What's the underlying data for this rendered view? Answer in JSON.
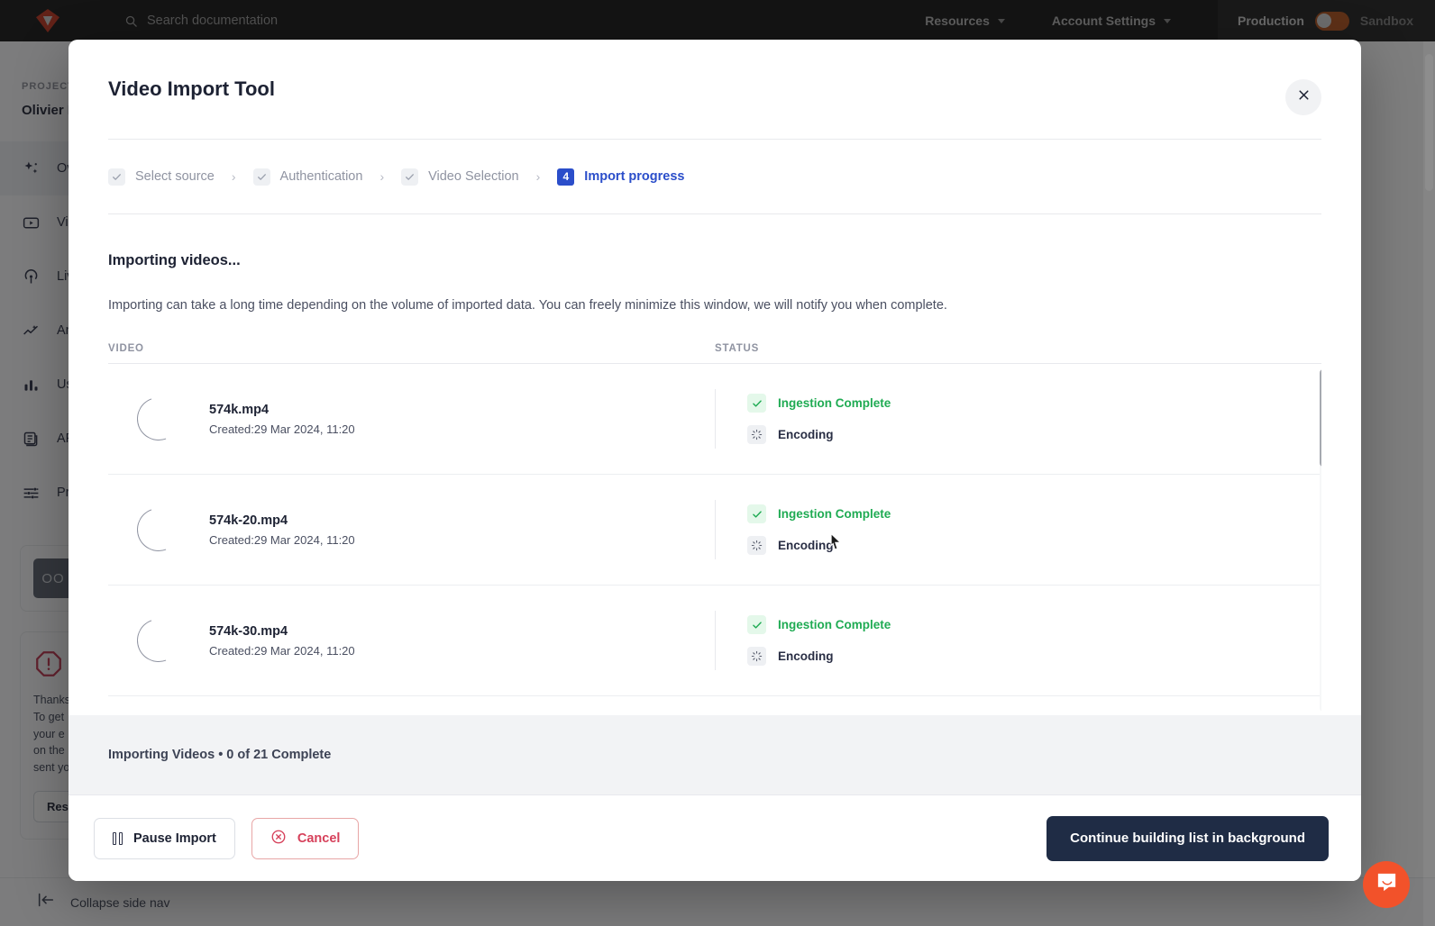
{
  "topbar": {
    "search_placeholder": "Search documentation",
    "search_icon": "search-icon",
    "menus": [
      {
        "label": "Resources",
        "icon": "chevron-down-icon"
      },
      {
        "label": "Account Settings",
        "icon": "chevron-down-icon"
      }
    ],
    "env_left": "Production",
    "env_right": "Sandbox",
    "toggle_color": "#b5521b"
  },
  "sidebar": {
    "project_label": "PROJECT:",
    "project_name": "Olivier P",
    "items": [
      {
        "label": "Ov",
        "icon": "sparkle-icon",
        "active": true
      },
      {
        "label": "Vi",
        "icon": "video-play-icon",
        "active": false
      },
      {
        "label": "Liv",
        "icon": "live-broadcast-icon",
        "active": false
      },
      {
        "label": "An",
        "icon": "analytics-trend-icon",
        "active": false
      },
      {
        "label": "Us",
        "icon": "bar-chart-icon",
        "active": false
      },
      {
        "label": "AP",
        "icon": "api-docs-icon",
        "active": false
      },
      {
        "label": "Pr",
        "icon": "sliders-icon",
        "active": false
      }
    ],
    "avatar_text": "OO",
    "warning_icon": "alert-octagon-icon",
    "warning_text": "Thanks\nTo get\nyour e\non the\nsent yo",
    "warning_button": "Res",
    "collapse_label": "Collapse side nav",
    "collapse_icon": "collapse-left-icon"
  },
  "modal": {
    "title": "Video Import Tool",
    "close_icon": "close-icon",
    "steps": [
      {
        "label": "Select source",
        "state": "complete",
        "icon": "check-icon"
      },
      {
        "label": "Authentication",
        "state": "complete",
        "icon": "check-icon"
      },
      {
        "label": "Video Selection",
        "state": "complete",
        "icon": "check-icon"
      },
      {
        "label": "Import progress",
        "state": "current",
        "number": "4"
      }
    ],
    "step_separator": "›",
    "section_title": "Importing videos...",
    "section_desc": "Importing can take a long time depending on the volume of imported data. You can freely minimize this window, we will notify you when complete.",
    "columns": {
      "video": "VIDEO",
      "status": "STATUS"
    },
    "rows": [
      {
        "name": "574k.mp4",
        "created": "Created:29 Mar 2024, 11:20",
        "thumb_icon": "loading-spinner-icon",
        "statuses": [
          {
            "label": "Ingestion Complete",
            "state": "done",
            "icon": "check-icon"
          },
          {
            "label": "Encoding",
            "state": "busy",
            "icon": "loading-spinner-icon"
          }
        ]
      },
      {
        "name": "574k-20.mp4",
        "created": "Created:29 Mar 2024, 11:20",
        "thumb_icon": "loading-spinner-icon",
        "statuses": [
          {
            "label": "Ingestion Complete",
            "state": "done",
            "icon": "check-icon"
          },
          {
            "label": "Encoding",
            "state": "busy",
            "icon": "loading-spinner-icon"
          }
        ]
      },
      {
        "name": "574k-30.mp4",
        "created": "Created:29 Mar 2024, 11:20",
        "thumb_icon": "loading-spinner-icon",
        "statuses": [
          {
            "label": "Ingestion Complete",
            "state": "done",
            "icon": "check-icon"
          },
          {
            "label": "Encoding",
            "state": "busy",
            "icon": "loading-spinner-icon"
          }
        ]
      }
    ],
    "status_bar": "Importing  Videos  •  0 of 21 Complete",
    "buttons": {
      "pause": "Pause Import",
      "pause_icon": "pause-icon",
      "cancel": "Cancel",
      "cancel_icon": "cancel-circle-icon",
      "primary": "Continue building list in background"
    }
  },
  "chat": {
    "icon": "chat-bubble-icon",
    "color": "#f2522a"
  },
  "colors": {
    "accent_blue": "#2b4eca",
    "success_green": "#1fab53",
    "danger_red": "#d6405a",
    "primary_navy": "#1f2c45"
  }
}
